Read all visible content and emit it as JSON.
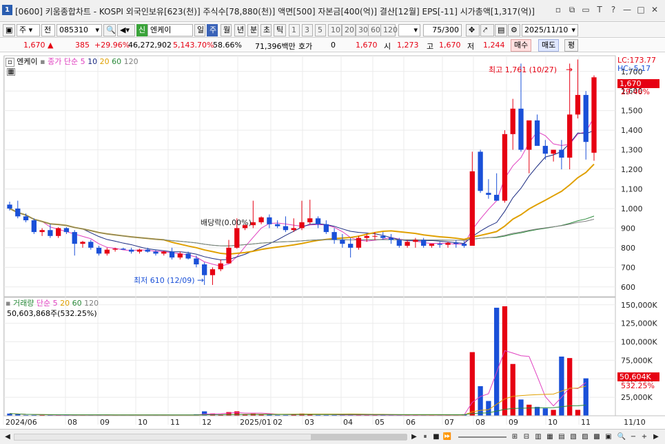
{
  "window": {
    "app_number": "1",
    "title": "[0600] 키움종합차트 - KOSPI 외국인보유[623(천)] 주식수[78,880(천)] 액면[500] 자본금[400(억)] 결산[12월] EPS[-11] 시가총액[1,317(억)]",
    "controls": [
      "▫",
      "⧉",
      "▭",
      "T",
      "?",
      "—",
      "□",
      "✕"
    ]
  },
  "toolbar": {
    "period_main": "주",
    "stock_type": "전",
    "stock_code": "085310",
    "market_badge": "신",
    "stock_name": "엔케이",
    "period_tabs": [
      "일",
      "주",
      "월",
      "년",
      "분",
      "초",
      "틱"
    ],
    "active_period": "주",
    "interval_buttons": [
      "1",
      "3",
      "5",
      "10",
      "20",
      "30",
      "60",
      "120"
    ],
    "bar_count": "75",
    "bar_total": "/300",
    "date": "2025/11/10"
  },
  "quote": {
    "price": "1,670",
    "change": "385",
    "change_pct": "+29.96%",
    "volume": "46,272,902",
    "volume_pct": "5,143.70%",
    "turnover": "58.66%",
    "amount": "71,396백만",
    "hoga_label": "호가",
    "hoga_value": "0",
    "hoga_price": "1,670",
    "open_label": "시",
    "open": "1,273",
    "high_label": "고",
    "high": "1,670",
    "low_label": "저",
    "low": "1,244",
    "buy": "매수",
    "sell": "매도",
    "avg": "평"
  },
  "price_panel": {
    "legend_name": "엔케이",
    "legend_ma_label": "종가 단순",
    "ma_periods": [
      "5",
      "10",
      "20",
      "60",
      "120"
    ],
    "ma_colors": [
      "#e040c0",
      "#1a2a80",
      "#e0a000",
      "#2a8a3a",
      "#808080"
    ],
    "lc_label": "LC:173.77",
    "hc_label": "HC:-5.17",
    "current_price_tag": "1,670",
    "current_pct_tag": "29.46%",
    "y_ticks": [
      "1,700",
      "1,600",
      "1,500",
      "1,400",
      "1,300",
      "1,200",
      "1,100",
      "1,000",
      "900",
      "800",
      "700",
      "600"
    ],
    "high_annotation": "최고 1,761 (10/27)",
    "low_annotation": "최저 610 (12/09)",
    "dividend_annotation": "배당락(0.00%)"
  },
  "volume_panel": {
    "legend_label": "거래량",
    "legend_ma_label": "단순",
    "ma_periods": [
      "5",
      "20",
      "60",
      "120"
    ],
    "current_volume": "50,603,868주(532.25%)",
    "y_ticks": [
      "150,000K",
      "125,000K",
      "100,000K",
      "75,000K",
      "50,000K",
      "25,000K"
    ],
    "volume_tag": "50,604K",
    "volume_pct_tag": "532.25%"
  },
  "x_axis": {
    "labels": [
      "2024/06",
      "08",
      "09",
      "10",
      "11",
      "12",
      "2025/01",
      "02",
      "03",
      "04",
      "05",
      "06",
      "07",
      "08",
      "09",
      "10",
      "11",
      "11/10"
    ]
  },
  "chart_data": {
    "type": "candlestick",
    "title": "엔케이",
    "ylim": [
      550,
      1780
    ],
    "up_color": "#e60012",
    "down_color": "#1a50d8",
    "candles": [
      [
        1020,
        1035,
        990,
        1000
      ],
      [
        1000,
        1040,
        950,
        960
      ],
      [
        960,
        975,
        930,
        940
      ],
      [
        940,
        950,
        870,
        880
      ],
      [
        880,
        900,
        860,
        890
      ],
      [
        890,
        920,
        850,
        860
      ],
      [
        860,
        905,
        850,
        900
      ],
      [
        900,
        905,
        870,
        880
      ],
      [
        880,
        890,
        760,
        820
      ],
      [
        820,
        835,
        800,
        830
      ],
      [
        830,
        840,
        790,
        800
      ],
      [
        800,
        810,
        760,
        770
      ],
      [
        770,
        800,
        760,
        790
      ],
      [
        790,
        800,
        780,
        795
      ],
      [
        795,
        800,
        790,
        790
      ],
      [
        790,
        800,
        770,
        780
      ],
      [
        780,
        795,
        770,
        790
      ],
      [
        790,
        800,
        775,
        780
      ],
      [
        780,
        790,
        760,
        770
      ],
      [
        770,
        785,
        760,
        780
      ],
      [
        780,
        800,
        740,
        750
      ],
      [
        750,
        780,
        740,
        770
      ],
      [
        770,
        780,
        740,
        745
      ],
      [
        745,
        760,
        700,
        715
      ],
      [
        715,
        725,
        610,
        660
      ],
      [
        660,
        700,
        610,
        690
      ],
      [
        690,
        740,
        680,
        720
      ],
      [
        720,
        840,
        720,
        800
      ],
      [
        800,
        950,
        795,
        900
      ],
      [
        900,
        920,
        890,
        915
      ],
      [
        915,
        1040,
        900,
        930
      ],
      [
        930,
        960,
        920,
        955
      ],
      [
        955,
        970,
        900,
        920
      ],
      [
        920,
        940,
        900,
        910
      ],
      [
        910,
        960,
        880,
        890
      ],
      [
        890,
        950,
        880,
        900
      ],
      [
        900,
        1040,
        890,
        930
      ],
      [
        930,
        1045,
        920,
        950
      ],
      [
        950,
        960,
        900,
        920
      ],
      [
        920,
        940,
        870,
        880
      ],
      [
        880,
        900,
        820,
        840
      ],
      [
        840,
        870,
        800,
        820
      ],
      [
        820,
        850,
        750,
        800
      ],
      [
        800,
        860,
        790,
        850
      ],
      [
        850,
        870,
        830,
        860
      ],
      [
        860,
        880,
        840,
        860
      ],
      [
        860,
        880,
        840,
        850
      ],
      [
        850,
        870,
        820,
        840
      ],
      [
        840,
        850,
        800,
        810
      ],
      [
        810,
        840,
        800,
        830
      ],
      [
        830,
        850,
        800,
        840
      ],
      [
        840,
        850,
        800,
        810
      ],
      [
        810,
        820,
        800,
        820
      ],
      [
        820,
        830,
        800,
        815
      ],
      [
        815,
        830,
        800,
        825
      ],
      [
        825,
        840,
        800,
        820
      ],
      [
        820,
        835,
        800,
        810
      ],
      [
        810,
        1290,
        810,
        1190
      ],
      [
        1290,
        1300,
        1080,
        1090
      ],
      [
        1080,
        1150,
        1050,
        1070
      ],
      [
        1070,
        1180,
        1050,
        1040
      ],
      [
        1040,
        1400,
        1030,
        1380
      ],
      [
        1380,
        1560,
        1300,
        1510
      ],
      [
        1510,
        1740,
        1290,
        1300
      ],
      [
        1300,
        1370,
        1180,
        1450
      ],
      [
        1450,
        1480,
        1350,
        1320
      ],
      [
        1320,
        1350,
        1250,
        1280
      ],
      [
        1280,
        1300,
        1240,
        1300
      ],
      [
        1300,
        1350,
        1200,
        1260
      ],
      [
        1260,
        1740,
        1200,
        1480
      ],
      [
        1480,
        1761,
        1460,
        1580
      ],
      [
        1580,
        1600,
        1250,
        1340
      ],
      [
        1285,
        1680,
        1244,
        1670
      ]
    ],
    "volume": [
      3,
      2,
      1,
      1,
      1,
      1,
      1,
      1,
      1,
      1,
      1,
      1,
      1,
      1,
      1,
      1,
      1,
      1,
      1,
      1,
      1,
      1,
      1,
      2,
      6,
      3,
      2,
      5,
      6,
      2,
      3,
      2,
      2,
      1,
      1,
      2,
      3,
      2,
      1,
      1,
      1,
      1,
      2,
      1,
      1,
      1,
      1,
      1,
      1,
      1,
      1,
      1,
      1,
      1,
      1,
      1,
      2,
      86,
      40,
      20,
      146,
      148,
      70,
      22,
      15,
      12,
      10,
      8,
      80,
      78,
      8,
      50.6
    ],
    "volume_unit": "K (thousands)",
    "volume_ylim": [
      0,
      160000
    ]
  }
}
